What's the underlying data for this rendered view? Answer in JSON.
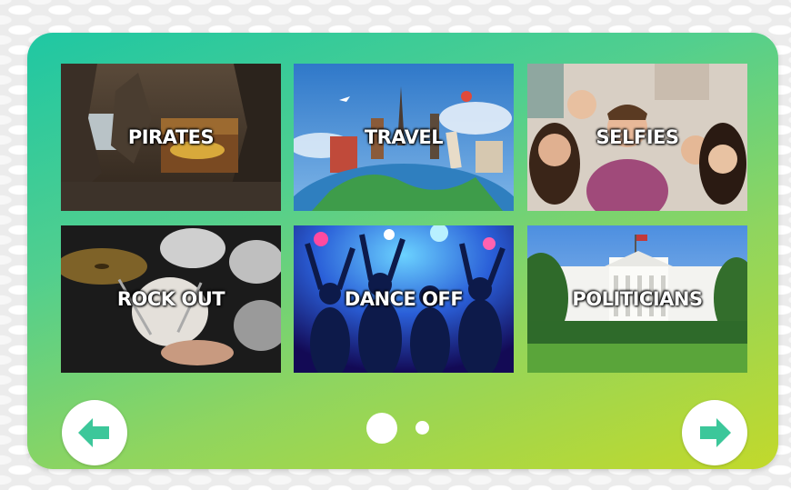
{
  "categories": [
    {
      "label": "PIRATES"
    },
    {
      "label": "TRAVEL"
    },
    {
      "label": "SELFIES"
    },
    {
      "label": "ROCK OUT"
    },
    {
      "label": "DANCE OFF"
    },
    {
      "label": "POLITICIANS"
    }
  ],
  "navigation": {
    "prev_icon": "arrow-left-icon",
    "next_icon": "arrow-right-icon",
    "arrow_color": "#3cc79a"
  },
  "pagination": {
    "current_page": 1,
    "total_pages": 2
  },
  "colors": {
    "panel_gradient_start": "#1fc7a3",
    "panel_gradient_end": "#c2d92b",
    "label_text": "#ffffff"
  }
}
